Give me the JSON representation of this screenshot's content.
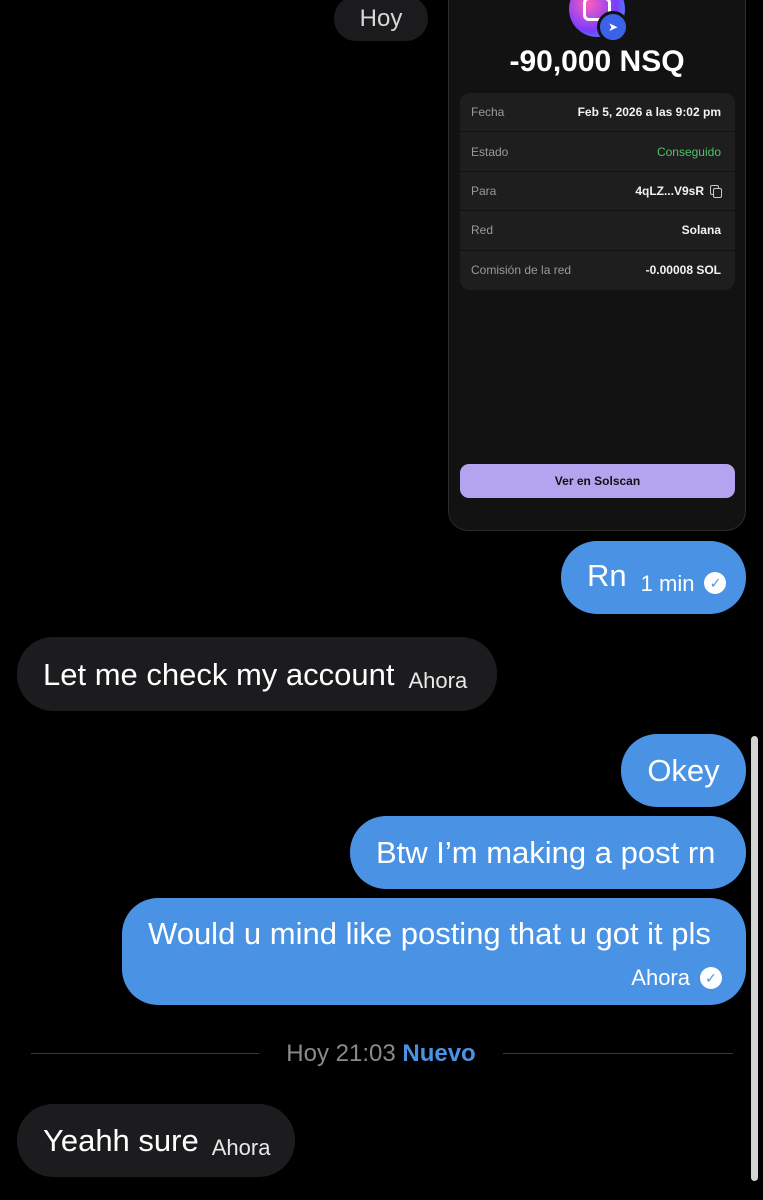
{
  "date_header": "Hoy",
  "shared_card": {
    "amount": "-90,000 NSQ",
    "rows": [
      {
        "label": "Fecha",
        "value": "Feb 5, 2026 a las 9:02 pm"
      },
      {
        "label": "Estado",
        "value": "Conseguido"
      },
      {
        "label": "Para",
        "value": "4qLZ...V9sR"
      },
      {
        "label": "Red",
        "value": "Solana"
      },
      {
        "label": "Comisión de la red",
        "value": "-0.00008 SOL"
      }
    ],
    "button_label": "Ver en Solscan",
    "status_color": "#4bc46a",
    "button_color": "#b4a3ef",
    "token_icon": "token-logo-icon",
    "badge_icon": "telegram-send-icon"
  },
  "messages": [
    {
      "direction": "out",
      "text": "Rn",
      "time": "1 min",
      "read": true
    },
    {
      "direction": "in",
      "text": "Let me check my account",
      "time": "Ahora"
    },
    {
      "direction": "out",
      "text": "Okey"
    },
    {
      "direction": "out",
      "text": "Btw I’m making a post rn"
    },
    {
      "direction": "out",
      "text": "Would u mind like posting that u got it pls",
      "time": "Ahora",
      "read": true
    },
    {
      "direction": "in",
      "text": "Yeahh sure",
      "time": "Ahora"
    }
  ],
  "divider": {
    "time": "Hoy 21:03",
    "new_label": "Nuevo"
  },
  "colors": {
    "outgoing_bubble": "#4a93e4",
    "incoming_bubble": "#1c1c1e",
    "background": "#000000"
  }
}
